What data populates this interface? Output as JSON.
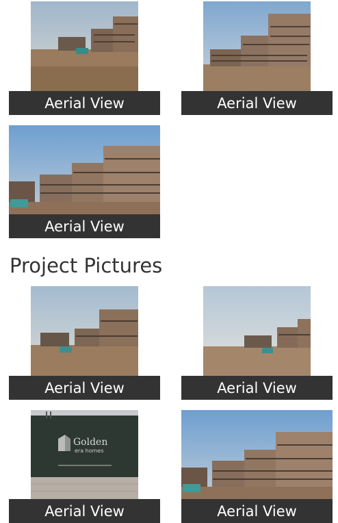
{
  "gallery_top": [
    {
      "caption": "Aerial View",
      "photo": "site-building-wide"
    },
    {
      "caption": "Aerial View",
      "photo": "site-building-right"
    },
    {
      "caption": "Aerial View",
      "photo": "site-building-close"
    }
  ],
  "section": {
    "title": "Project Pictures"
  },
  "gallery_bottom": [
    {
      "caption": "Aerial View",
      "photo": "site-building-wide"
    },
    {
      "caption": "Aerial View",
      "photo": "site-building-far"
    },
    {
      "caption": "Aerial View",
      "photo": "golden-era-homes-hoarding"
    },
    {
      "caption": "Aerial View",
      "photo": "site-building-close"
    }
  ],
  "hoarding": {
    "brand_line1": "Golden",
    "brand_line2": "era homes"
  },
  "colors": {
    "caption_bg": "#333333",
    "caption_text": "#ffffff",
    "title_text": "#333333"
  }
}
